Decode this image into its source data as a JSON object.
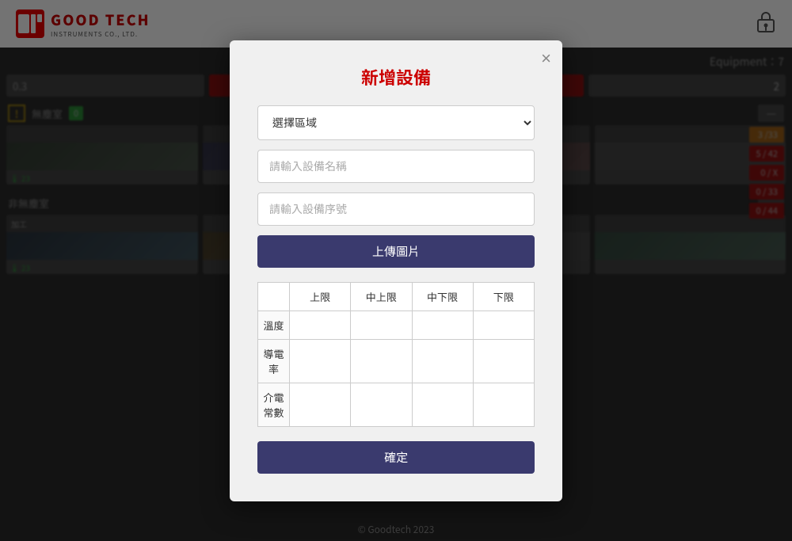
{
  "header": {
    "brand": "GOOD TECH",
    "subtitle": "INSTRUMENTS CO., LTD.",
    "lock_tooltip": "Lock"
  },
  "equip_bar": {
    "label": "Equipment：7"
  },
  "sections": [
    {
      "id": "cleanroom",
      "label": "無塵室",
      "has_warning": false,
      "has_badge": true,
      "badge_type": "green",
      "badge_value": "0",
      "minus": "—",
      "cards": 4
    },
    {
      "id": "non-cleanroom",
      "label": "非無塵室",
      "minus": "—",
      "cards": 4
    },
    {
      "id": "processing",
      "label": "加工",
      "cards": 4
    }
  ],
  "right_stats": [
    {
      "value": "3 /33",
      "type": "orange"
    },
    {
      "value": "5 / 42",
      "type": "red"
    },
    {
      "value": "0 / X",
      "type": "red"
    },
    {
      "value": "0 / 33",
      "type": "red"
    },
    {
      "value": "0 / 44",
      "type": "red"
    }
  ],
  "modal": {
    "title": "新增設備",
    "close_label": "×",
    "select_area_placeholder": "選擇區域",
    "device_name_placeholder": "請輸入設備名稱",
    "device_serial_placeholder": "請輸入設備序號",
    "upload_btn_label": "上傳圖片",
    "table": {
      "col_headers": [
        "上限",
        "中上限",
        "中下限",
        "下限"
      ],
      "rows": [
        {
          "label": "溫度"
        },
        {
          "label": "導電率"
        },
        {
          "label": "介電常數"
        }
      ]
    },
    "confirm_btn_label": "確定"
  },
  "footer": {
    "text": "© Goodtech 2023"
  },
  "top_bar": {
    "value1": "0.3",
    "val2": "2"
  }
}
